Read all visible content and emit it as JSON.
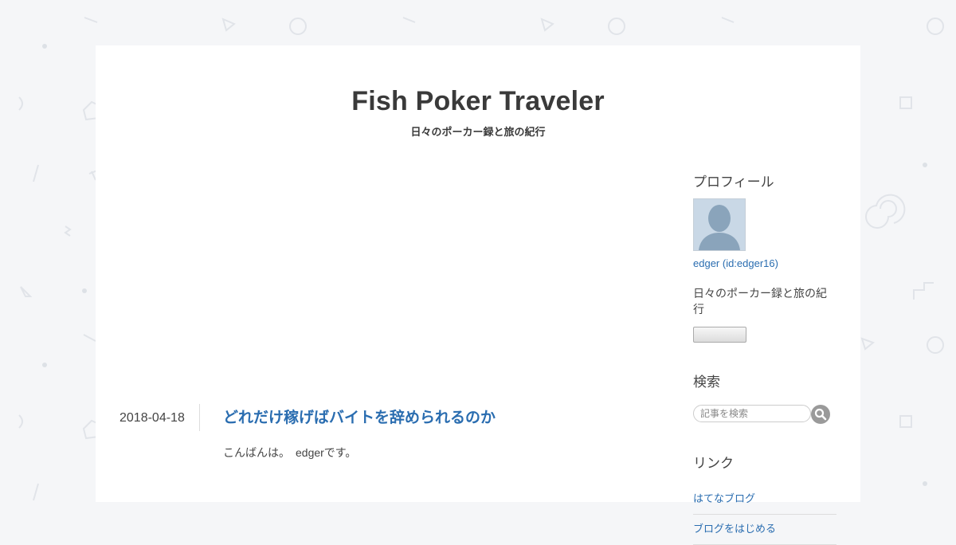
{
  "blog": {
    "title": "Fish Poker Traveler",
    "description": "日々のポーカー録と旅の紀行"
  },
  "entry": {
    "date": "2018-04-18",
    "title": "どれだけ稼げばバイトを辞められるのか",
    "body_first_line": "こんばんは。　edgerです。"
  },
  "sidebar": {
    "profile": {
      "title": "プロフィール",
      "avatar_icon": "default-user-avatar-icon",
      "user_link": "edger (id:edger16)",
      "description": "日々のポーカー録と旅の紀行"
    },
    "search": {
      "title": "検索",
      "placeholder": "記事を検索",
      "button_icon": "search-icon"
    },
    "links": {
      "title": "リンク",
      "items": [
        "はてなブログ",
        "ブログをはじめる"
      ]
    }
  },
  "colors": {
    "background": "#f5f6f8",
    "content_background": "#ffffff",
    "link": "#2a6db0",
    "text": "#3a3a3a"
  }
}
